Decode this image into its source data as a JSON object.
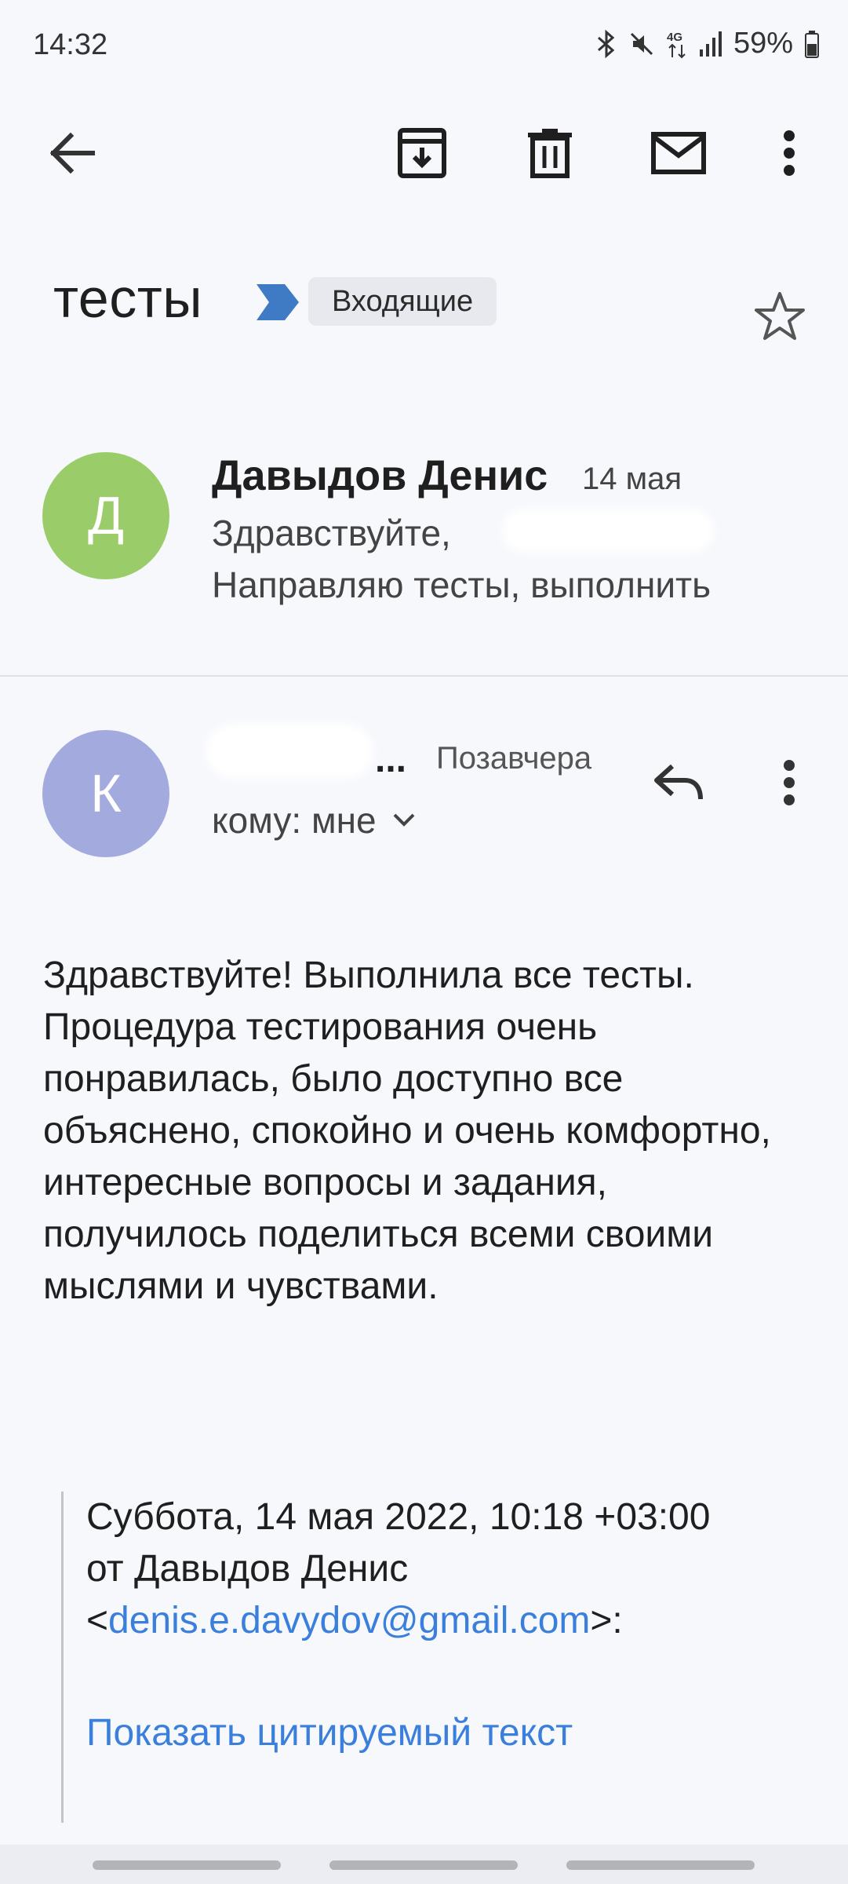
{
  "status_bar": {
    "time": "14:32",
    "battery_percent": "59%",
    "network": "4G",
    "icons": [
      "bluetooth-icon",
      "mute-icon",
      "network-4g-icon",
      "signal-icon",
      "battery-icon"
    ]
  },
  "toolbar": {
    "icons": [
      "back-arrow-icon",
      "archive-icon",
      "trash-icon",
      "mark-unread-icon",
      "more-vert-icon"
    ]
  },
  "subject": {
    "title": "тесты",
    "label": "Входящие",
    "label_color": "#3f7ac4"
  },
  "thread": {
    "message1": {
      "avatar_letter": "Д",
      "avatar_color": "#9acd69",
      "sender": "Давыдов Денис",
      "date": "14 мая",
      "snippet_line1": "Здравствуйте,",
      "snippet_line2": "Направляю тесты, выполнить"
    },
    "message2": {
      "avatar_letter": "К",
      "avatar_color": "#a2aade",
      "sender_ellipsis": "...",
      "date": "Позавчера",
      "to_prefix": "кому:",
      "to_value": "мне",
      "body": "Здравствуйте! Выполнила все тесты. Процедура тестирования очень понравилась, было доступно все объяснено, спокойно и очень комфортно, интересные вопросы и задания, получилось поделиться всеми своими мыслями и чувствами.",
      "quote_line1": "Суббота, 14 мая 2022, 10:18 +03:00",
      "quote_line2": "от Давыдов Денис",
      "quote_email_open": "<",
      "quote_email": "denis.e.davydov@gmail.com",
      "quote_email_close": ">:",
      "show_quoted": "Показать цитируемый текст",
      "link_color": "#3a7fdb"
    }
  }
}
